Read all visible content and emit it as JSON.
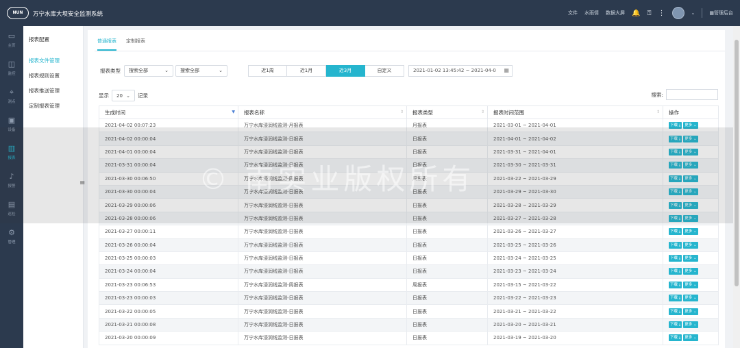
{
  "header": {
    "logo": "NUN",
    "title": "万宁水库大坝安全监测系统",
    "links": [
      "文件",
      "水雨情",
      "数据大屏"
    ],
    "admin": "管理后台"
  },
  "nav": [
    {
      "label": "主页",
      "icon": "monitor-icon"
    },
    {
      "label": "监控",
      "icon": "camera-icon"
    },
    {
      "label": "测点",
      "icon": "point-icon"
    },
    {
      "label": "设备",
      "icon": "device-icon"
    },
    {
      "label": "报表",
      "icon": "chart-icon",
      "active": true
    },
    {
      "label": "报警",
      "icon": "bell-icon"
    },
    {
      "label": "巡检",
      "icon": "calendar-icon"
    },
    {
      "label": "管理",
      "icon": "gear-icon"
    }
  ],
  "submenu": {
    "head": "报表配置",
    "items": [
      "报表文件管理",
      "报表规则设置",
      "报表推送管理",
      "定制报表管理"
    ]
  },
  "tabs": [
    "普通报表",
    "定制报表"
  ],
  "filter": {
    "label": "报表类型",
    "select1": "搜索全部",
    "select2": "搜索全部",
    "buttons": [
      "近1周",
      "近1月",
      "近3月",
      "自定义"
    ],
    "date_range": "2021-01-02 13:45:42 ~ 2021-04-0"
  },
  "list": {
    "show_prefix": "显示",
    "page_size": "20",
    "show_suffix": "记录",
    "search_label": "搜索:"
  },
  "table": {
    "headers": [
      "生成时间",
      "报表名称",
      "报表类型",
      "报表时间范围",
      "操作"
    ],
    "op_download": "下载",
    "op_more": "更多",
    "rows": [
      [
        "2021-04-02 00:07:23",
        "万宁水库浸润线监测-月报表",
        "月报表",
        "2021-03-01 ~ 2021-04-01"
      ],
      [
        "2021-04-02 00:00:04",
        "万宁水库浸润线监测-日报表",
        "日报表",
        "2021-04-01 ~ 2021-04-02"
      ],
      [
        "2021-04-01 00:00:04",
        "万宁水库浸润线监测-日报表",
        "日报表",
        "2021-03-31 ~ 2021-04-01"
      ],
      [
        "2021-03-31 00:00:04",
        "万宁水库浸润线监测-日报表",
        "日报表",
        "2021-03-30 ~ 2021-03-31"
      ],
      [
        "2021-03-30 00:06:50",
        "万宁水库浸润线监测-周报表",
        "周报表",
        "2021-03-22 ~ 2021-03-29"
      ],
      [
        "2021-03-30 00:00:04",
        "万宁水库浸润线监测-日报表",
        "日报表",
        "2021-03-29 ~ 2021-03-30"
      ],
      [
        "2021-03-29 00:00:06",
        "万宁水库浸润线监测-日报表",
        "日报表",
        "2021-03-28 ~ 2021-03-29"
      ],
      [
        "2021-03-28 00:00:06",
        "万宁水库浸润线监测-日报表",
        "日报表",
        "2021-03-27 ~ 2021-03-28"
      ],
      [
        "2021-03-27 00:00:11",
        "万宁水库浸润线监测-日报表",
        "日报表",
        "2021-03-26 ~ 2021-03-27"
      ],
      [
        "2021-03-26 00:00:04",
        "万宁水库浸润线监测-日报表",
        "日报表",
        "2021-03-25 ~ 2021-03-26"
      ],
      [
        "2021-03-25 00:00:03",
        "万宁水库浸润线监测-日报表",
        "日报表",
        "2021-03-24 ~ 2021-03-25"
      ],
      [
        "2021-03-24 00:00:04",
        "万宁水库浸润线监测-日报表",
        "日报表",
        "2021-03-23 ~ 2021-03-24"
      ],
      [
        "2021-03-23 00:06:53",
        "万宁水库浸润线监测-周报表",
        "周报表",
        "2021-03-15 ~ 2021-03-22"
      ],
      [
        "2021-03-23 00:00:03",
        "万宁水库浸润线监测-日报表",
        "日报表",
        "2021-03-22 ~ 2021-03-23"
      ],
      [
        "2021-03-22 00:00:05",
        "万宁水库浸润线监测-日报表",
        "日报表",
        "2021-03-21 ~ 2021-03-22"
      ],
      [
        "2021-03-21 00:00:08",
        "万宁水库浸润线监测-日报表",
        "日报表",
        "2021-03-20 ~ 2021-03-21"
      ],
      [
        "2021-03-20 00:00:09",
        "万宁水库浸润线监测-日报表",
        "日报表",
        "2021-03-19 ~ 2021-03-20"
      ]
    ]
  },
  "watermark": "© 南实业版权所有",
  "colors": {
    "accent": "#25b5ce",
    "header_bg": "#2c3a4e"
  }
}
